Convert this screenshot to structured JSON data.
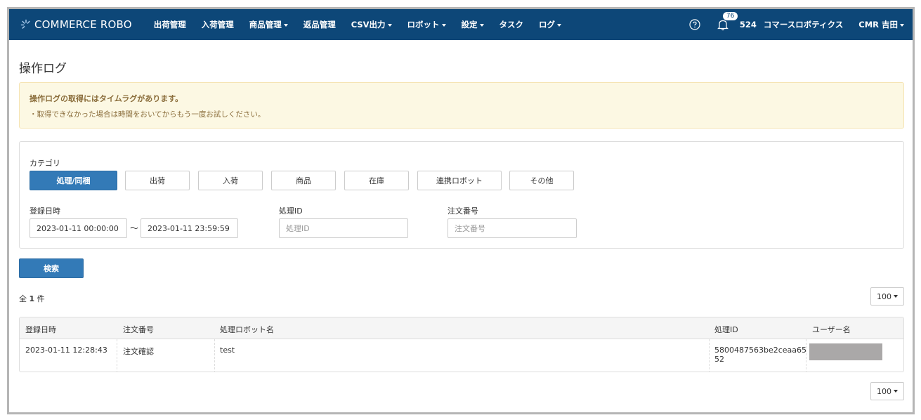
{
  "brand": {
    "name": "COMMERCE ROBO",
    "mark": "★"
  },
  "nav": {
    "items": [
      {
        "label": "出荷管理",
        "dropdown": false
      },
      {
        "label": "入荷管理",
        "dropdown": false
      },
      {
        "label": "商品管理",
        "dropdown": true
      },
      {
        "label": "返品管理",
        "dropdown": false
      },
      {
        "label": "CSV出力",
        "dropdown": true
      },
      {
        "label": "ロボット",
        "dropdown": true
      },
      {
        "label": "設定",
        "dropdown": true
      },
      {
        "label": "タスク",
        "dropdown": false
      },
      {
        "label": "ログ",
        "dropdown": true
      }
    ],
    "notification_count": "76",
    "count": "524",
    "company": "コマースロボティクス",
    "user": "CMR 吉田"
  },
  "page": {
    "title": "操作ログ",
    "alert_title": "操作ログの取得にはタイムラグがあります。",
    "alert_body": "・取得できなかった場合は時間をおいてからもう一度お試しください。"
  },
  "filters": {
    "category_label": "カテゴリ",
    "categories": [
      "処理/同梱",
      "出荷",
      "入荷",
      "商品",
      "在庫",
      "連携ロボット",
      "その他"
    ],
    "active_category": "処理/同梱",
    "date_label": "登録日時",
    "date_from": "2023-01-11 00:00:00",
    "date_to": "2023-01-11 23:59:59",
    "tilde": "〜",
    "process_id_label": "処理ID",
    "process_id_placeholder": "処理ID",
    "order_no_label": "注文番号",
    "order_no_placeholder": "注文番号",
    "search_button": "検索"
  },
  "results": {
    "total_prefix": "全",
    "total_count": "1",
    "total_suffix": "件",
    "page_size": "100",
    "columns": [
      "登録日時",
      "注文番号",
      "処理ロボット名",
      "処理ID",
      "ユーザー名"
    ],
    "rows": [
      {
        "registered": "2023-01-11 12:28:43",
        "order_no": "注文確認",
        "robot_name": "test",
        "process_id_line1": "5800487563be2ceaa65",
        "process_id_line2": "52",
        "user": ""
      }
    ]
  },
  "colors": {
    "navbar": "#0d4778",
    "primary": "#337ab7",
    "alert_bg": "#fcf8e3",
    "alert_text": "#8a6d3b"
  }
}
